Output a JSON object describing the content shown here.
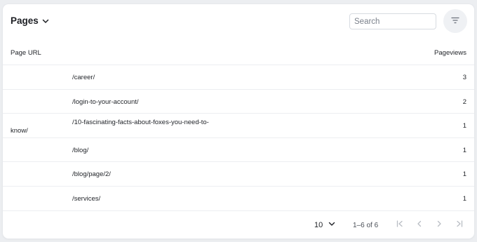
{
  "header": {
    "title": "Pages",
    "search_placeholder": "Search"
  },
  "columns": {
    "url": "Page URL",
    "views": "Pageviews"
  },
  "rows": [
    {
      "url": "/career/",
      "views": "3"
    },
    {
      "url": "/login-to-your-account/",
      "views": "2"
    },
    {
      "url": "/10-fascinating-facts-about-foxes-you-need-to-",
      "url_wrap": "know/",
      "views": "1"
    },
    {
      "url": "/blog/",
      "views": "1"
    },
    {
      "url": "/blog/page/2/",
      "views": "1"
    },
    {
      "url": "/services/",
      "views": "1"
    }
  ],
  "pagination": {
    "rows_per_page": "10",
    "range": "1–6 of 6"
  },
  "icons": {
    "title_chevron": "chevron-down-icon",
    "filter": "filter-icon",
    "rpp_chevron": "chevron-down-icon",
    "first": "first-page-icon",
    "prev": "chevron-left-icon",
    "next": "chevron-right-icon",
    "last": "last-page-icon"
  },
  "colors": {
    "background": "#eceef1",
    "card": "#ffffff",
    "text": "#1d1f24",
    "disabled_icon": "#b9bdc4"
  }
}
